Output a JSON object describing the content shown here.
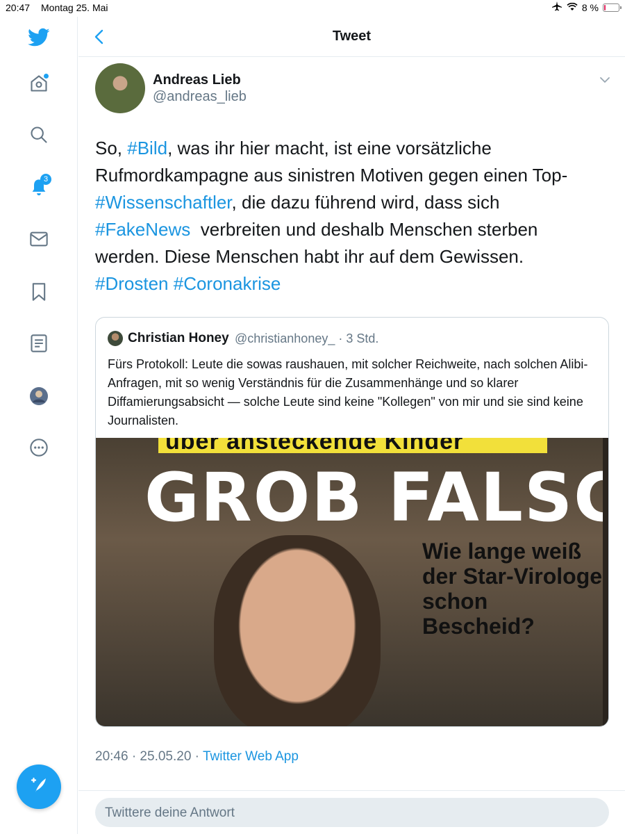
{
  "status_bar": {
    "time": "20:47",
    "date": "Montag 25. Mai",
    "battery": "8 %",
    "battery_level": 0.08
  },
  "sidebar": {
    "items": [
      {
        "name": "twitter-logo-icon"
      },
      {
        "name": "home-icon"
      },
      {
        "name": "search-icon"
      },
      {
        "name": "notifications-icon",
        "badge": "3"
      },
      {
        "name": "messages-icon"
      },
      {
        "name": "bookmarks-icon"
      },
      {
        "name": "lists-icon"
      },
      {
        "name": "profile-icon"
      },
      {
        "name": "more-icon"
      }
    ],
    "compose_icon": "compose-tweet-icon"
  },
  "header": {
    "title": "Tweet"
  },
  "tweet": {
    "display_name": "Andreas Lieb",
    "handle": "@andreas_lieb",
    "text_parts": [
      "So, ",
      "#Bild",
      ", was ihr hier macht, ist eine vorsätzliche Rufmordkampagne aus sinistren Motiven gegen einen Top-",
      "#Wissenschaftler",
      ", die dazu führend wird, dass sich ",
      "#FakeNews",
      "  verbreiten und deshalb Menschen sterben werden. Diese Menschen habt ihr auf dem Gewissen. ",
      "#Drosten",
      " ",
      "#Coronakrise"
    ],
    "timestamp": "20:46 · 25.05.20 · ",
    "source": "Twitter Web App"
  },
  "quote": {
    "display_name": "Christian Honey",
    "meta": "@christianhoney_ · 3 Std.",
    "text": "Fürs Protokoll: Leute die sowas raushauen, mit solcher Reichweite, nach solchen Alibi-Anfragen, mit so wenig Verständnis für die Zusammenhänge und so klarer Diffamierungsabsicht — solche Leute sind keine \"Kollegen\" von mir und sie sind keine Journalisten.",
    "image": {
      "strip_text": "über ansteckende Kinder",
      "headline": "GROB FALSCH",
      "subtext": "Wie lange weiß der Star-Virologe schon Bescheid?"
    }
  },
  "reply": {
    "placeholder": "Twittere deine Antwort"
  }
}
